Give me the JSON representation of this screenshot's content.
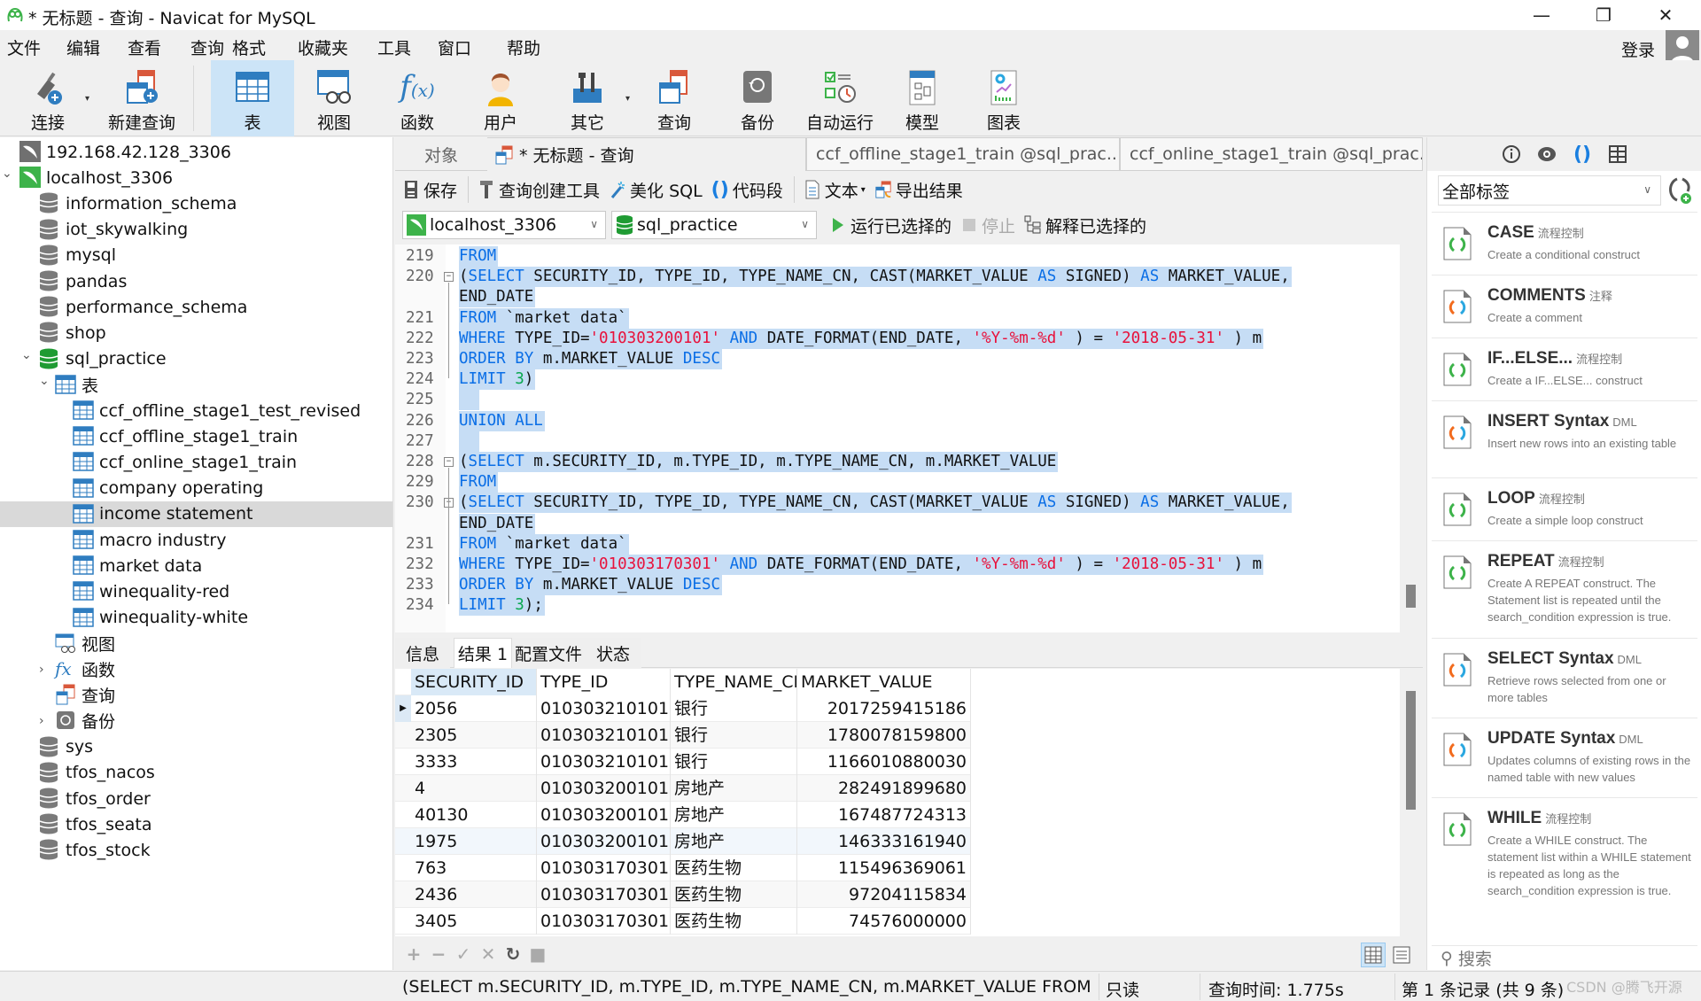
{
  "window": {
    "title": "* 无标题 - 查询 - Navicat for MySQL",
    "controls": [
      "minimize",
      "restore",
      "close"
    ]
  },
  "menu": {
    "items": [
      "文件",
      "编辑",
      "查看",
      "查询",
      "格式",
      "收藏夹",
      "工具",
      "窗口",
      "帮助"
    ],
    "login": "登录"
  },
  "toolbar": {
    "buttons": [
      {
        "label": "连接",
        "icon": "plug-add-icon",
        "has_dropdown": true
      },
      {
        "label": "新建查询",
        "icon": "new-query-icon"
      },
      {
        "label": "表",
        "icon": "table-icon",
        "active": true
      },
      {
        "label": "视图",
        "icon": "view-icon"
      },
      {
        "label": "函数",
        "icon": "function-icon"
      },
      {
        "label": "用户",
        "icon": "user-icon"
      },
      {
        "label": "其它",
        "icon": "tools-icon",
        "has_dropdown": true
      },
      {
        "label": "查询",
        "icon": "query-icon"
      },
      {
        "label": "备份",
        "icon": "backup-icon"
      },
      {
        "label": "自动运行",
        "icon": "auto-run-icon"
      },
      {
        "label": "模型",
        "icon": "model-icon"
      },
      {
        "label": "图表",
        "icon": "chart-icon"
      }
    ]
  },
  "navigator": {
    "items": [
      {
        "label": "192.168.42.128_3306",
        "type": "connection-gray",
        "level": 0,
        "expand": ""
      },
      {
        "label": "localhost_3306",
        "type": "connection-green",
        "level": 0,
        "expand": "open"
      },
      {
        "label": "information_schema",
        "type": "database",
        "level": 1,
        "expand": ""
      },
      {
        "label": "iot_skywalking",
        "type": "database",
        "level": 1,
        "expand": ""
      },
      {
        "label": "mysql",
        "type": "database",
        "level": 1,
        "expand": ""
      },
      {
        "label": "pandas",
        "type": "database",
        "level": 1,
        "expand": ""
      },
      {
        "label": "performance_schema",
        "type": "database",
        "level": 1,
        "expand": ""
      },
      {
        "label": "shop",
        "type": "database",
        "level": 1,
        "expand": ""
      },
      {
        "label": "sql_practice",
        "type": "database-open",
        "level": 1,
        "expand": "open"
      },
      {
        "label": "表",
        "type": "tables-folder",
        "level": 2,
        "expand": "open"
      },
      {
        "label": "ccf_offline_stage1_test_revised",
        "type": "table",
        "level": 3,
        "expand": ""
      },
      {
        "label": "ccf_offline_stage1_train",
        "type": "table",
        "level": 3,
        "expand": ""
      },
      {
        "label": "ccf_online_stage1_train",
        "type": "table",
        "level": 3,
        "expand": ""
      },
      {
        "label": "company operating",
        "type": "table",
        "level": 3,
        "expand": ""
      },
      {
        "label": "income statement",
        "type": "table",
        "level": 3,
        "expand": "",
        "selected": true
      },
      {
        "label": "macro industry",
        "type": "table",
        "level": 3,
        "expand": ""
      },
      {
        "label": "market data",
        "type": "table",
        "level": 3,
        "expand": ""
      },
      {
        "label": "winequality-red",
        "type": "table",
        "level": 3,
        "expand": ""
      },
      {
        "label": "winequality-white",
        "type": "table",
        "level": 3,
        "expand": ""
      },
      {
        "label": "视图",
        "type": "views-folder",
        "level": 2,
        "expand": ""
      },
      {
        "label": "函数",
        "type": "functions-folder",
        "level": 2,
        "expand": "closed"
      },
      {
        "label": "查询",
        "type": "queries-folder",
        "level": 2,
        "expand": ""
      },
      {
        "label": "备份",
        "type": "backups-folder",
        "level": 2,
        "expand": "closed"
      },
      {
        "label": "sys",
        "type": "database",
        "level": 1,
        "expand": ""
      },
      {
        "label": "tfos_nacos",
        "type": "database",
        "level": 1,
        "expand": ""
      },
      {
        "label": "tfos_order",
        "type": "database",
        "level": 1,
        "expand": ""
      },
      {
        "label": "tfos_seata",
        "type": "database",
        "level": 1,
        "expand": ""
      },
      {
        "label": "tfos_stock",
        "type": "database",
        "level": 1,
        "expand": ""
      }
    ]
  },
  "tabs": {
    "objects": "对象",
    "active": "* 无标题 - 查询",
    "others": [
      "ccf_offline_stage1_train @sql_prac...",
      "ccf_online_stage1_train @sql_prac..."
    ]
  },
  "query_toolbar": {
    "save": "保存",
    "query_builder": "查询创建工具",
    "beautify": "美化 SQL",
    "snippet": "代码段",
    "text": "文本",
    "export": "导出结果"
  },
  "connection_bar": {
    "connection": "localhost_3306",
    "database": "sql_practice",
    "run_selected": "运行已选择的",
    "stop": "停止",
    "explain_selected": "解释已选择的"
  },
  "editor": {
    "lines": [
      {
        "n": "219",
        "fold": "",
        "tokens": [
          [
            "kw",
            "FROM"
          ]
        ]
      },
      {
        "n": "220",
        "fold": "box",
        "tokens": [
          [
            "",
            "("
          ],
          [
            "kw",
            "SELECT"
          ],
          [
            "",
            " SECURITY_ID, TYPE_ID, TYPE_NAME_CN, CAST(MARKET_VALUE "
          ],
          [
            "kw",
            "AS"
          ],
          [
            "",
            " SIGNED) "
          ],
          [
            "kw",
            "AS"
          ],
          [
            "",
            " MARKET_VALUE,"
          ]
        ]
      },
      {
        "n": "",
        "fold": "",
        "tokens": [
          [
            "",
            "END_DATE"
          ]
        ]
      },
      {
        "n": "221",
        "fold": "",
        "tokens": [
          [
            "kw",
            "FROM"
          ],
          [
            "",
            " `market data`"
          ]
        ]
      },
      {
        "n": "222",
        "fold": "",
        "tokens": [
          [
            "kw",
            "WHERE"
          ],
          [
            "",
            " TYPE_ID="
          ],
          [
            "str",
            "'010303200101'"
          ],
          [
            "",
            "",
            " "
          ],
          [
            "kw",
            " AND"
          ],
          [
            "",
            " DATE_FORMAT(END_DATE, "
          ],
          [
            "str",
            "'%Y-%m-%d'"
          ],
          [
            "",
            " ) = "
          ],
          [
            "str",
            "'2018-05-31'"
          ],
          [
            "",
            " ) m"
          ]
        ]
      },
      {
        "n": "223",
        "fold": "",
        "tokens": [
          [
            "kw",
            "ORDER BY"
          ],
          [
            "",
            " m.MARKET_VALUE "
          ],
          [
            "kw",
            "DESC"
          ]
        ]
      },
      {
        "n": "224",
        "fold": "",
        "tokens": [
          [
            "kw",
            "LIMIT"
          ],
          [
            "",
            " "
          ],
          [
            "num",
            "3"
          ],
          [
            "",
            ")"
          ]
        ]
      },
      {
        "n": "225",
        "fold": "",
        "tokens": [
          [
            "",
            "  "
          ]
        ]
      },
      {
        "n": "226",
        "fold": "",
        "tokens": [
          [
            "kw",
            "UNION ALL"
          ]
        ]
      },
      {
        "n": "227",
        "fold": "",
        "tokens": [
          [
            "",
            "  "
          ]
        ]
      },
      {
        "n": "228",
        "fold": "box",
        "tokens": [
          [
            "",
            "("
          ],
          [
            "kw",
            "SELECT"
          ],
          [
            "",
            " m.SECURITY_ID, m.TYPE_ID, m.TYPE_NAME_CN, m.MARKET_VALUE"
          ]
        ]
      },
      {
        "n": "229",
        "fold": "",
        "tokens": [
          [
            "kw",
            "FROM"
          ]
        ]
      },
      {
        "n": "230",
        "fold": "box",
        "tokens": [
          [
            "",
            "("
          ],
          [
            "kw",
            "SELECT"
          ],
          [
            "",
            " SECURITY_ID, TYPE_ID, TYPE_NAME_CN, CAST(MARKET_VALUE "
          ],
          [
            "kw",
            "AS"
          ],
          [
            "",
            " SIGNED) "
          ],
          [
            "kw",
            "AS"
          ],
          [
            "",
            " MARKET_VALUE,"
          ]
        ]
      },
      {
        "n": "",
        "fold": "",
        "tokens": [
          [
            "",
            "END_DATE"
          ]
        ]
      },
      {
        "n": "231",
        "fold": "",
        "tokens": [
          [
            "kw",
            "FROM"
          ],
          [
            "",
            " `market data`"
          ]
        ]
      },
      {
        "n": "232",
        "fold": "",
        "tokens": [
          [
            "kw",
            "WHERE"
          ],
          [
            "",
            " TYPE_ID="
          ],
          [
            "str",
            "'010303170301'"
          ],
          [
            "kw",
            " AND"
          ],
          [
            "",
            " DATE_FORMAT(END_DATE, "
          ],
          [
            "str",
            "'%Y-%m-%d'"
          ],
          [
            "",
            " ) = "
          ],
          [
            "str",
            "'2018-05-31'"
          ],
          [
            "",
            " ) m"
          ]
        ]
      },
      {
        "n": "233",
        "fold": "",
        "tokens": [
          [
            "kw",
            "ORDER BY"
          ],
          [
            "",
            " m.MARKET_VALUE "
          ],
          [
            "kw",
            "DESC"
          ]
        ]
      },
      {
        "n": "234",
        "fold": "",
        "tokens": [
          [
            "kw",
            "LIMIT"
          ],
          [
            "",
            " "
          ],
          [
            "num",
            "3"
          ],
          [
            "",
            ");"
          ]
        ]
      }
    ]
  },
  "result_tabs": [
    "信息",
    "结果 1",
    "配置文件",
    "状态"
  ],
  "result_active_tab": "结果 1",
  "grid": {
    "columns": [
      "SECURITY_ID",
      "TYPE_ID",
      "TYPE_NAME_CN",
      "MARKET_VALUE"
    ],
    "rows": [
      [
        "2056",
        "010303210101",
        "银行",
        "2017259415186"
      ],
      [
        "2305",
        "010303210101",
        "银行",
        "1780078159800"
      ],
      [
        "3333",
        "010303210101",
        "银行",
        "1166010880030"
      ],
      [
        "4",
        "010303200101",
        "房地产",
        "282491899680"
      ],
      [
        "40130",
        "010303200101",
        "房地产",
        "167487724313"
      ],
      [
        "1975",
        "010303200101",
        "房地产",
        "146333161940"
      ],
      [
        "763",
        "010303170301",
        "医药生物",
        "115496369061"
      ],
      [
        "2436",
        "010303170301",
        "医药生物",
        "97204115834"
      ],
      [
        "3405",
        "010303170301",
        "医药生物",
        "74576000000"
      ]
    ],
    "current_row": 1
  },
  "status": {
    "sql": "(SELECT m.SECURITY_ID, m.TYPE_ID, m.TYPE_NAME_CN, m.MARKET_VALUE FROM (SELECT SECURITY_ID",
    "readonly": "只读",
    "query_time": "查询时间: 1.775s",
    "record": "第 1 条记录 (共 9 条)"
  },
  "right_panel": {
    "filter": "全部标签",
    "search_placeholder": "搜索",
    "snippets": [
      {
        "title": "CASE",
        "tag": "流程控制",
        "desc": "Create a conditional construct",
        "color": "green"
      },
      {
        "title": "COMMENTS",
        "tag": "注释",
        "desc": "Create a comment",
        "color": "multi"
      },
      {
        "title": "IF...ELSE...",
        "tag": "流程控制",
        "desc": "Create a IF...ELSE... construct",
        "color": "green"
      },
      {
        "title": "INSERT Syntax",
        "tag": "DML",
        "desc": "Insert new rows into an existing table",
        "color": "multi"
      },
      {
        "title": "LOOP",
        "tag": "流程控制",
        "desc": "Create a simple loop construct",
        "color": "green"
      },
      {
        "title": "REPEAT",
        "tag": "流程控制",
        "desc": "Create A REPEAT construct. The Statement list is repeated until the search_condition expression is true.",
        "color": "green"
      },
      {
        "title": "SELECT Syntax",
        "tag": "DML",
        "desc": "Retrieve rows selected from one or more tables",
        "color": "multi"
      },
      {
        "title": "UPDATE Syntax",
        "tag": "DML",
        "desc": "Updates columns of existing rows in the named table with new values",
        "color": "multi"
      },
      {
        "title": "WHILE",
        "tag": "流程控制",
        "desc": "Create a WHILE construct. The statement list within a WHILE statement is repeated as long as the search_condition expression is true.",
        "color": "green"
      }
    ]
  },
  "watermark": "CSDN @腾飞开源",
  "colors": {
    "accent": "#2f7dc0",
    "selection": "#c6ddf5",
    "keyword": "#0a6ee6",
    "string": "#e8113b",
    "number": "#0aa84f",
    "active_tab": "#cce4f7"
  }
}
